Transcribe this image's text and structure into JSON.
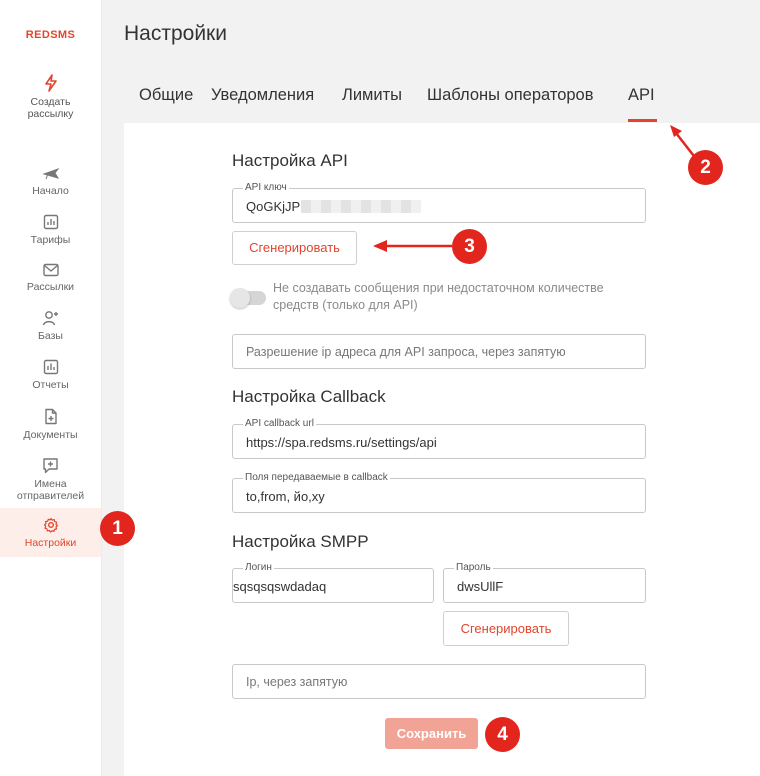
{
  "brand": {
    "logo": "REDSMS",
    "accent": "#e2452e"
  },
  "sidebar": {
    "create": "Создать рассылку",
    "items": [
      {
        "label": "Начало",
        "icon": "plane-icon"
      },
      {
        "label": "Тарифы",
        "icon": "chart-icon"
      },
      {
        "label": "Рассылки",
        "icon": "mail-icon"
      },
      {
        "label": "Базы",
        "icon": "users-icon"
      },
      {
        "label": "Отчеты",
        "icon": "report-icon"
      },
      {
        "label": "Документы",
        "icon": "document-icon"
      },
      {
        "label": "Имена отправителей",
        "icon": "sender-icon"
      },
      {
        "label": "Настройки",
        "icon": "gear-icon",
        "active": true
      }
    ]
  },
  "header": {
    "title": "Настройки"
  },
  "tabs": [
    "Общие",
    "Уведомления",
    "Лимиты",
    "Шаблоны операторов",
    "API"
  ],
  "api": {
    "title": "Настройка API",
    "key_label": "API ключ",
    "key_value": "QoGKjJPr",
    "generate": "Сгенерировать",
    "toggle_text": "Не создавать сообщения при недостаточном количестве средств (только для API)",
    "ip_placeholder": "Разрешение ip адреса для API запроса, через запятую"
  },
  "callback": {
    "title": "Настройка Callback",
    "url_label": "API callback url",
    "url_value": "https://spa.redsms.ru/settings/api",
    "fields_label": "Поля передаваемые в callback",
    "fields_value": "to,from, йо,ху"
  },
  "smpp": {
    "title": "Настройка SMPP",
    "login_label": "Логин",
    "login_value": "sqsqsqswdadaq",
    "password_label": "Пароль",
    "password_value": "dwsUllF",
    "generate": "Сгенерировать",
    "ip_placeholder": "Ip, через запятую"
  },
  "save": "Сохранить",
  "badges": [
    "1",
    "2",
    "3",
    "4"
  ]
}
